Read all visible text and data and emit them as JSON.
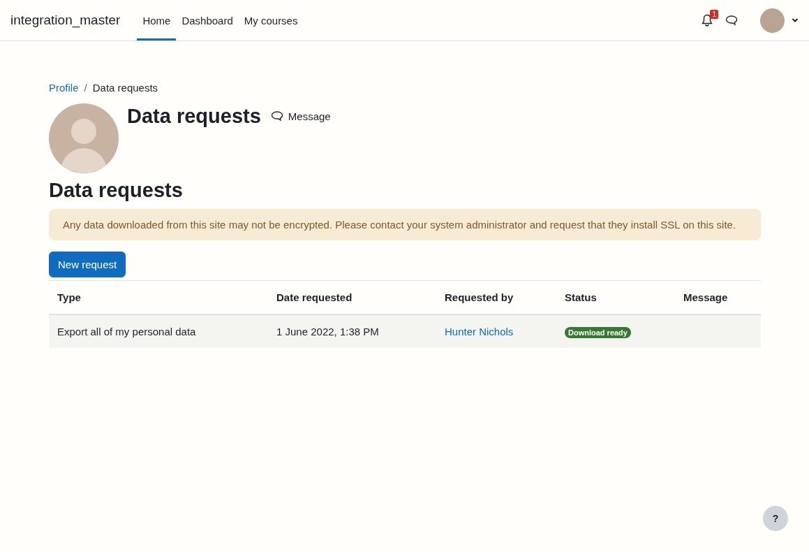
{
  "navbar": {
    "site_name": "integration_master",
    "items": [
      {
        "label": "Home",
        "selected": true
      },
      {
        "label": "Dashboard",
        "selected": false
      },
      {
        "label": "My courses",
        "selected": false
      }
    ],
    "notification_count": "1"
  },
  "breadcrumb_separator": "/",
  "breadcrumb": [
    {
      "label": "Profile",
      "kind": "link"
    },
    {
      "label": "Data requests",
      "kind": "current"
    }
  ],
  "header": {
    "title": "Data requests",
    "message_label": "Message"
  },
  "page_heading": "Data requests",
  "alert": "Any data downloaded from this site may not be encrypted. Please contact your system administrator and request that they install SSL on this site.",
  "new_request_button": "New request",
  "table": {
    "columns": [
      "Type",
      "Date requested",
      "Requested by",
      "Status",
      "Message"
    ],
    "rows": [
      {
        "type": "Export all of my personal data",
        "date": "1 June 2022, 1:38 PM",
        "requested_by": "Hunter Nichols",
        "status": "Download ready",
        "color": "#357a32"
      }
    ]
  },
  "help_button": "?"
}
